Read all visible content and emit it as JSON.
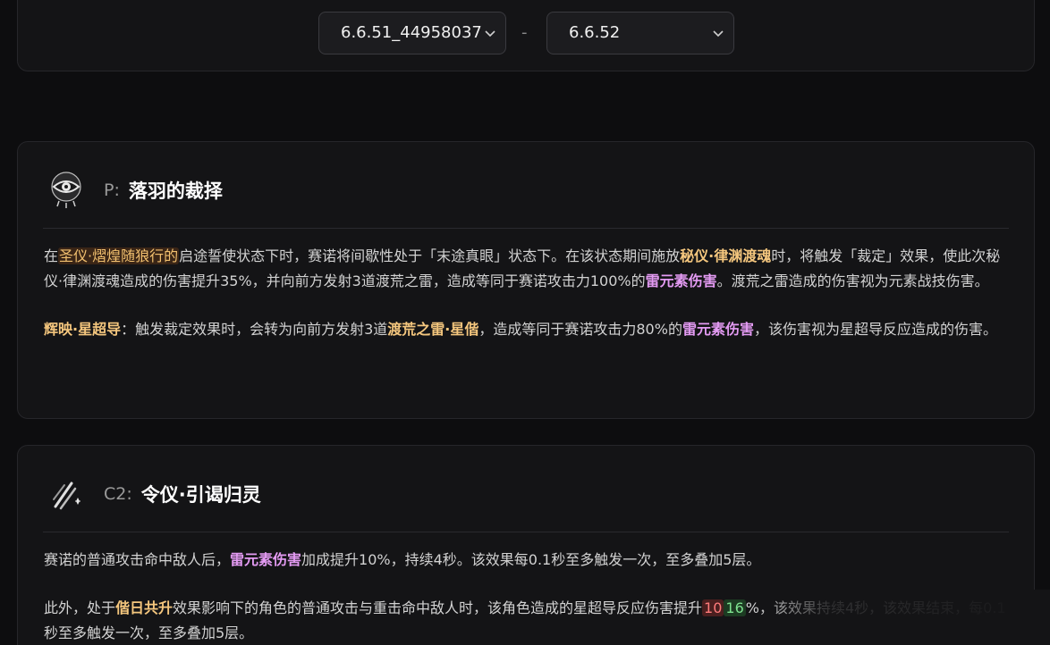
{
  "version_compare": {
    "from_version": "6.6.51_44958037",
    "separator": "-",
    "to_version": "6.6.52"
  },
  "passive": {
    "prefix": "P:",
    "title": "落羽的裁择",
    "icon": "eye-sigil-icon",
    "p1": {
      "t1": "在",
      "h1": "圣仪·熠煌随狼行的",
      "t2": "启途誓使状态下时，赛诺将间歇性处于「末途真眼」状态下。在该状态期间施放",
      "h2": "秘仪·律渊渡魂",
      "t3": "时，将触发「裁定」效果，使此次秘仪·律渊渡魂造成的伤害提升35%，并向前方发射3道渡荒之雷，造成等同于赛诺攻击力100%的",
      "h3": "雷元素伤害",
      "t4": "。渡荒之雷造成的伤害视为元素战技伤害。"
    },
    "p2": {
      "h1": "辉映·星超导",
      "t1": "：触发裁定效果时，会转为向前方发射3道",
      "h2": "渡荒之雷·星偕",
      "t2": "，造成等同于赛诺攻击力80%的",
      "h3": "雷元素伤害",
      "t3": "，该伤害视为星超导反应造成的伤害。"
    }
  },
  "c2": {
    "prefix": "C2:",
    "title": "令仪·引谒归灵",
    "icon": "claw-slash-icon",
    "p1": {
      "t1": "赛诺的普通攻击命中敌人后，",
      "h1": "雷元素伤害",
      "t2": "加成提升10%，持续4秒。该效果每0.1秒至多触发一次，至多叠加5层。"
    },
    "p2": {
      "t1": "此外，处于",
      "h1": "偕日共升",
      "t2": "效果影响下的角色的普通攻击与重击命中敌人时，该角色造成的星超导反应伤害提升",
      "old": "10",
      "new": "16",
      "t3": "%，该效果持续4秒，该效果结束，每0.1秒至多触发一次，至多叠加5层。"
    }
  },
  "colors": {
    "background": "#0d0d0f",
    "card": "#141416",
    "highlight_gold": "#f5c77e",
    "highlight_purple": "#e49bf3",
    "removed_value": "#ff7b7b",
    "added_value": "#7ee28f"
  }
}
